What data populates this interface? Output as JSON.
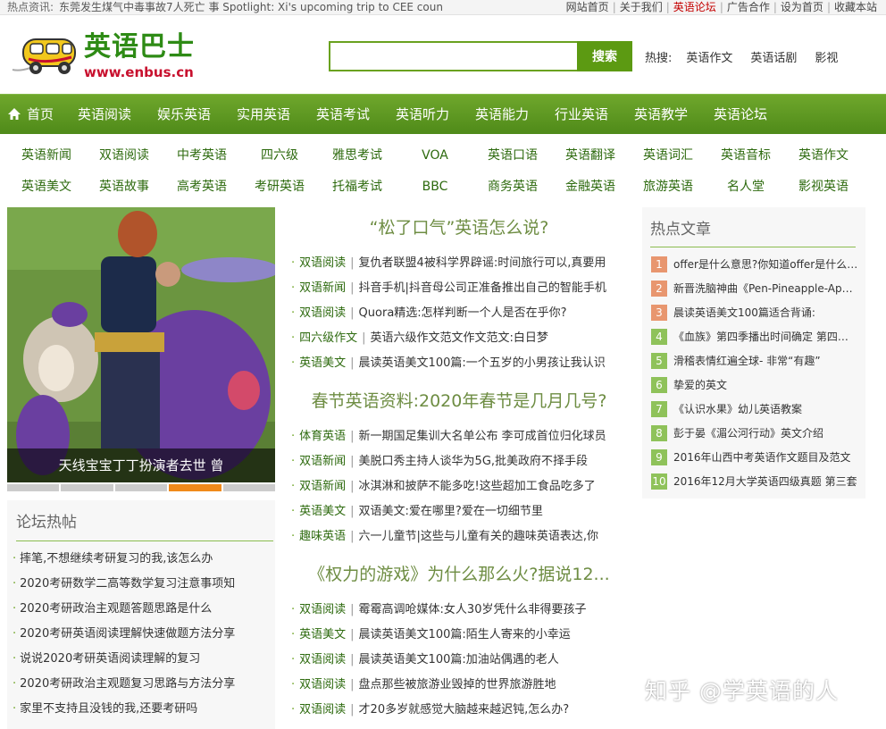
{
  "topbar": {
    "ticker_label": "热点资讯:",
    "ticker_text": "东莞发生煤气中毒事故7人死亡 事 Spotlight: Xi's upcoming trip to CEE coun",
    "links": [
      {
        "label": "网站首页"
      },
      {
        "label": "关于我们"
      },
      {
        "label": "英语论坛",
        "highlight": true
      },
      {
        "label": "广告合作"
      },
      {
        "label": "设为首页"
      },
      {
        "label": "收藏本站"
      }
    ]
  },
  "logo": {
    "cn": "英语巴士",
    "en": "www.enbus.cn"
  },
  "search": {
    "placeholder": "",
    "value": "",
    "button": "搜索"
  },
  "hot_search": {
    "label": "热搜:",
    "items": [
      "英语作文",
      "英语话剧",
      "影视"
    ]
  },
  "main_nav": [
    "首页",
    "英语阅读",
    "娱乐英语",
    "实用英语",
    "英语考试",
    "英语听力",
    "英语能力",
    "行业英语",
    "英语教学",
    "英语论坛"
  ],
  "sub_nav": {
    "row1": [
      "英语新闻",
      "双语阅读",
      "中考英语",
      "四六级",
      "雅思考试",
      "VOA",
      "英语口语",
      "英语翻译",
      "英语词汇",
      "英语音标",
      "英语作文"
    ],
    "row2": [
      "英语美文",
      "英语故事",
      "高考英语",
      "考研英语",
      "托福考试",
      "BBC",
      "商务英语",
      "金融英语",
      "旅游英语",
      "名人堂",
      "影视英语"
    ]
  },
  "slideshow": {
    "caption": "天线宝宝丁丁扮演者去世 曾",
    "slides": 5,
    "active_slide": 4
  },
  "forum": {
    "title": "论坛热帖",
    "items": [
      "摔笔,不想继续考研复习的我,该怎么办",
      "2020考研数学二高等数学复习注意事项知",
      "2020考研政治主观题答题思路是什么",
      "2020考研英语阅读理解快速做题方法分享",
      "说说2020考研英语阅读理解的复习",
      "2020考研政治主观题复习思路与方法分享",
      "家里不支持且没钱的我,还要考研吗"
    ]
  },
  "sections": [
    {
      "title": "“松了口气”英语怎么说?",
      "articles": [
        {
          "cat": "双语阅读",
          "text": "复仇者联盟4被科学界辟谣:时间旅行可以,真要用"
        },
        {
          "cat": "双语新闻",
          "text": "抖音手机|抖音母公司正准备推出自己的智能手机"
        },
        {
          "cat": "双语阅读",
          "text": "Quora精选:怎样判断一个人是否在乎你?"
        },
        {
          "cat": "四六级作文",
          "text": "英语六级作文范文作文范文:白日梦"
        },
        {
          "cat": "英语美文",
          "text": "晨读英语美文100篇:一个五岁的小男孩让我认识"
        }
      ]
    },
    {
      "title": "春节英语资料:2020年春节是几月几号?",
      "articles": [
        {
          "cat": "体育英语",
          "text": "新一期国足集训大名单公布 李可成首位归化球员"
        },
        {
          "cat": "双语新闻",
          "text": "美脱口秀主持人谈华为5G,批美政府不择手段"
        },
        {
          "cat": "双语新闻",
          "text": "冰淇淋和披萨不能多吃!这些超加工食品吃多了"
        },
        {
          "cat": "英语美文",
          "text": "双语美文:爱在哪里?爱在一切细节里"
        },
        {
          "cat": "趣味英语",
          "text": "六一儿童节|这些与儿童有关的趣味英语表达,你"
        }
      ]
    },
    {
      "title": "《权力的游戏》为什么那么火?据说12...",
      "articles": [
        {
          "cat": "双语阅读",
          "text": "霉霉高调呛媒体:女人30岁凭什么非得要孩子"
        },
        {
          "cat": "英语美文",
          "text": "晨读英语美文100篇:陌生人寄来的小幸运"
        },
        {
          "cat": "双语阅读",
          "text": "晨读英语美文100篇:加油站偶遇的老人"
        },
        {
          "cat": "双语阅读",
          "text": "盘点那些被旅游业毁掉的世界旅游胜地"
        },
        {
          "cat": "双语阅读",
          "text": "才20多岁就感觉大脑越来越迟钝,怎么办?"
        }
      ]
    }
  ],
  "hot_articles": {
    "title": "热点文章",
    "items": [
      {
        "num": "1",
        "text": "offer是什么意思?你知道offer是什么意思吗"
      },
      {
        "num": "2",
        "text": "新晋洗脑神曲《Pen-Pineapple-Apple-Pen》"
      },
      {
        "num": "3",
        "text": "晨读英语美文100篇适合背诵:"
      },
      {
        "num": "4",
        "text": "《血族》第四季播出时间确定 第四季什么时候"
      },
      {
        "num": "5",
        "text": "滑稽表情红遍全球- 非常“有趣”"
      },
      {
        "num": "6",
        "text": "挚爱的英文"
      },
      {
        "num": "7",
        "text": "《认识水果》幼儿英语教案"
      },
      {
        "num": "8",
        "text": "彭于晏《湄公河行动》英文介绍"
      },
      {
        "num": "9",
        "text": "2016年山西中考英语作文题目及范文"
      },
      {
        "num": "10",
        "text": "2016年12月大学英语四级真题 第三套"
      }
    ],
    "colors": {
      "top": "#e8966f",
      "rest": "#8fc25a"
    }
  },
  "watermark": "知乎 @学英语的人",
  "colors": {
    "nav_green": "#5c9a12",
    "text_green": "#2d6a0e",
    "accent_orange": "#f08a1a"
  }
}
